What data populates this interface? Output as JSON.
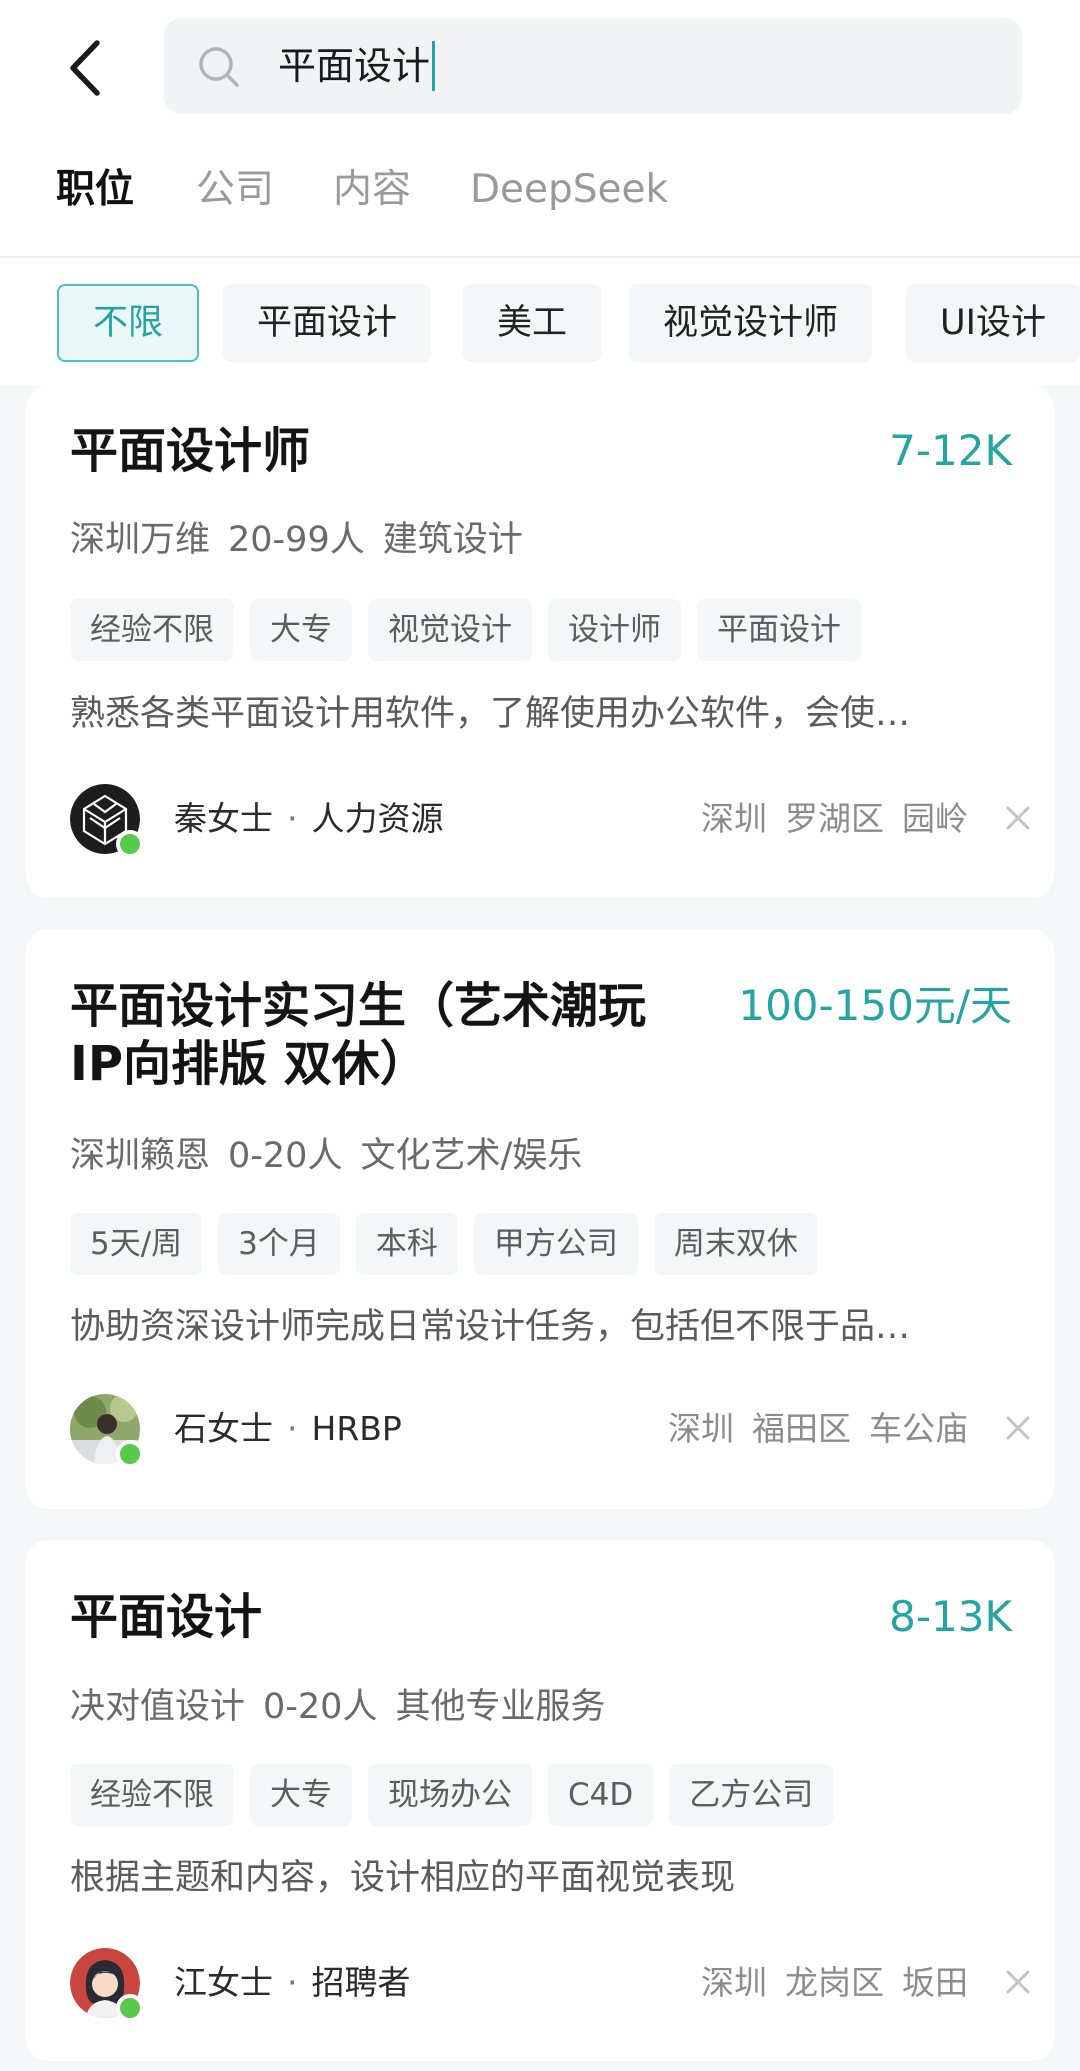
{
  "search": {
    "query": "平面设计"
  },
  "tabs": [
    {
      "label": "职位",
      "active": true
    },
    {
      "label": "公司",
      "active": false
    },
    {
      "label": "内容",
      "active": false
    },
    {
      "label": "DeepSeek",
      "active": false
    }
  ],
  "filters": [
    {
      "label": "不限",
      "active": true
    },
    {
      "label": "平面设计",
      "active": false
    },
    {
      "label": "美工",
      "active": false
    },
    {
      "label": "视觉设计师",
      "active": false
    },
    {
      "label": "UI设计",
      "active": false
    }
  ],
  "colors": {
    "accent": "#24a5a4",
    "online": "#58c94b",
    "background": "#f5f6f7"
  },
  "jobs": [
    {
      "title": "平面设计师",
      "salary": "7-12K",
      "company": "深圳万维",
      "size": "20-99人",
      "industry": "建筑设计",
      "tags": [
        "经验不限",
        "大专",
        "视觉设计",
        "设计师",
        "平面设计"
      ],
      "description": "熟悉各类平面设计用软件，了解使用办公软件，会使…",
      "recruiter": {
        "name": "秦女士",
        "role": "人力资源"
      },
      "location": [
        "深圳",
        "罗湖区",
        "园岭"
      ]
    },
    {
      "title_line1": "平面设计实习生（艺术潮玩",
      "title_line2": "IP向排版 双休）",
      "salary": "100-150元/天",
      "company": "深圳籁恩",
      "size": "0-20人",
      "industry": "文化艺术/娱乐",
      "tags": [
        "5天/周",
        "3个月",
        "本科",
        "甲方公司",
        "周末双休"
      ],
      "description": "协助资深设计师完成日常设计任务，包括但不限于品…",
      "recruiter": {
        "name": "石女士",
        "role": "HRBP"
      },
      "location": [
        "深圳",
        "福田区",
        "车公庙"
      ]
    },
    {
      "title": "平面设计",
      "salary": "8-13K",
      "company": "决对值设计",
      "size": "0-20人",
      "industry": "其他专业服务",
      "tags": [
        "经验不限",
        "大专",
        "现场办公",
        "C4D",
        "乙方公司"
      ],
      "description": "根据主题和内容，设计相应的平面视觉表现",
      "recruiter": {
        "name": "江女士",
        "role": "招聘者"
      },
      "location": [
        "深圳",
        "龙岗区",
        "坂田"
      ]
    }
  ]
}
